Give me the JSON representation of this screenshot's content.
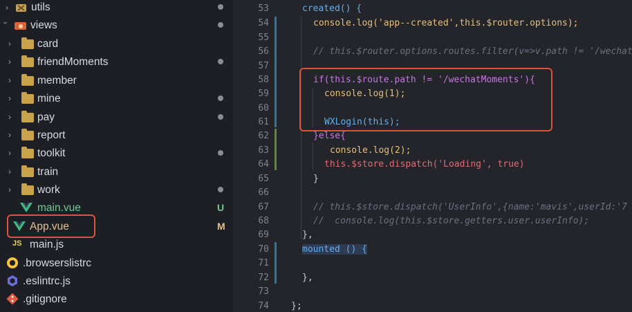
{
  "sidebar": {
    "items": [
      {
        "name": "utils",
        "type": "folder",
        "expanded": false,
        "status": "dot"
      },
      {
        "name": "views",
        "type": "folder-open",
        "expanded": true,
        "status": "dot"
      },
      {
        "name": "card",
        "type": "folder",
        "expanded": false,
        "status": ""
      },
      {
        "name": "friendMoments",
        "type": "folder",
        "expanded": false,
        "status": "dot"
      },
      {
        "name": "member",
        "type": "folder",
        "expanded": false,
        "status": ""
      },
      {
        "name": "mine",
        "type": "folder",
        "expanded": false,
        "status": "dot"
      },
      {
        "name": "pay",
        "type": "folder",
        "expanded": false,
        "status": "dot"
      },
      {
        "name": "report",
        "type": "folder",
        "expanded": false,
        "status": ""
      },
      {
        "name": "toolkit",
        "type": "folder",
        "expanded": false,
        "status": "dot"
      },
      {
        "name": "train",
        "type": "folder",
        "expanded": false,
        "status": ""
      },
      {
        "name": "work",
        "type": "folder",
        "expanded": false,
        "status": "dot"
      },
      {
        "name": "main.vue",
        "type": "vue",
        "badge": "U"
      },
      {
        "name": "App.vue",
        "type": "vue",
        "badge": "M"
      },
      {
        "name": "main.js",
        "type": "js"
      },
      {
        "name": ".browserslistrc",
        "type": "config"
      },
      {
        "name": ".eslintrc.js",
        "type": "eslint"
      },
      {
        "name": ".gitignore",
        "type": "git"
      }
    ],
    "icon_labels": {
      "js": "JS"
    }
  },
  "editor": {
    "lines": [
      {
        "num": "53",
        "code": "created() {"
      },
      {
        "num": "54",
        "code": "console.log('app--created',this.$router.options);"
      },
      {
        "num": "55",
        "code": ""
      },
      {
        "num": "56",
        "code": "// this.$router.options.routes.filter(v=>v.path != '/wechat"
      },
      {
        "num": "57",
        "code": ""
      },
      {
        "num": "58",
        "code": "if(this.$route.path != '/wechatMoments'){"
      },
      {
        "num": "59",
        "code": "console.log(1);"
      },
      {
        "num": "60",
        "code": ""
      },
      {
        "num": "61",
        "code": "WXLogin(this);"
      },
      {
        "num": "62",
        "code": "}else{"
      },
      {
        "num": "63",
        "code": "console.log(2);"
      },
      {
        "num": "64",
        "code": "this.$store.dispatch('Loading', true)"
      },
      {
        "num": "65",
        "code": "}"
      },
      {
        "num": "66",
        "code": ""
      },
      {
        "num": "67",
        "code": "// this.$store.dispatch('UserInfo',{name:'mavis',userId:'7"
      },
      {
        "num": "68",
        "code": "//  console.log(this.$store.getters.user.userInfo);"
      },
      {
        "num": "69",
        "code": "},"
      },
      {
        "num": "70",
        "code": "mounted () {"
      },
      {
        "num": "71",
        "code": ""
      },
      {
        "num": "72",
        "code": "},"
      },
      {
        "num": "73",
        "code": ""
      },
      {
        "num": "74",
        "code": "};"
      }
    ]
  },
  "colors": {
    "highlight": "#e0533b",
    "untracked": "#73c991",
    "modified": "#e2c08d"
  }
}
